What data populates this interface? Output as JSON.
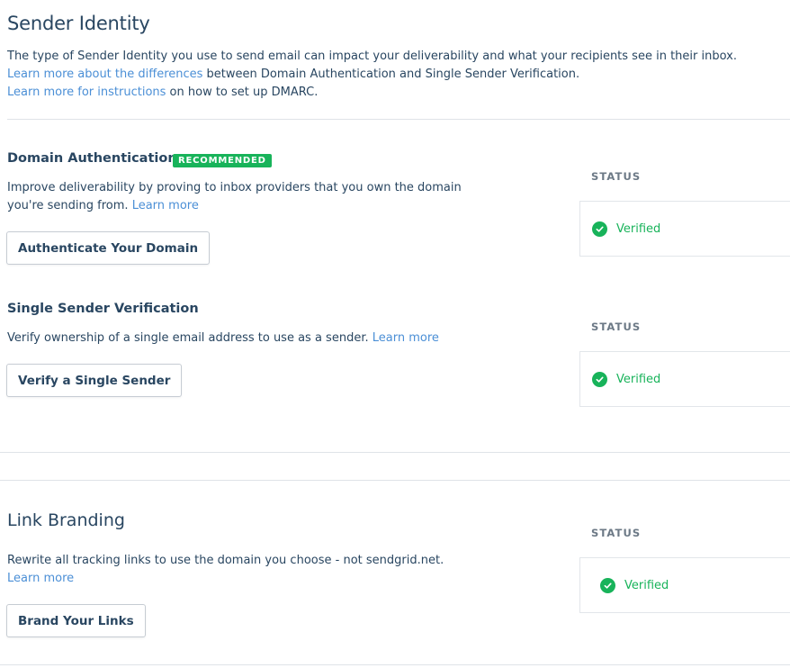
{
  "header": {
    "title": "Sender Identity",
    "intro_line1": "The type of Sender Identity you use to send email can impact your deliverability and what your recipients see in their inbox.",
    "intro_line2_link": "Learn more about the differences",
    "intro_line2_rest": " between Domain Authentication and Single Sender Verification.",
    "intro_line3_link": "Learn more for instructions",
    "intro_line3_rest": " on how to set up DMARC."
  },
  "domain_auth": {
    "title": "Domain Authentication",
    "badge": "RECOMMENDED",
    "description": "Improve deliverability by proving to inbox providers that you own the domain you're sending from.",
    "learn_more": "Learn more",
    "button": "Authenticate Your Domain",
    "status_label": "STATUS",
    "status_value": "Verified"
  },
  "single_sender": {
    "title": "Single Sender Verification",
    "description": "Verify ownership of a single email address to use as a sender.",
    "learn_more": "Learn more",
    "button": "Verify a Single Sender",
    "status_label": "STATUS",
    "status_value": "Verified"
  },
  "link_branding": {
    "title": "Link Branding",
    "description": "Rewrite all tracking links to use the domain you choose - not sendgrid.net.",
    "learn_more": "Learn more",
    "button": "Brand Your Links",
    "status_label": "STATUS",
    "status_value": "Verified"
  },
  "colors": {
    "text": "#294661",
    "link": "#4b8fd6",
    "success": "#18b35a",
    "muted": "#6c7986",
    "border": "#dfe3e8"
  },
  "icons": {
    "verified": "check-circle-icon"
  }
}
